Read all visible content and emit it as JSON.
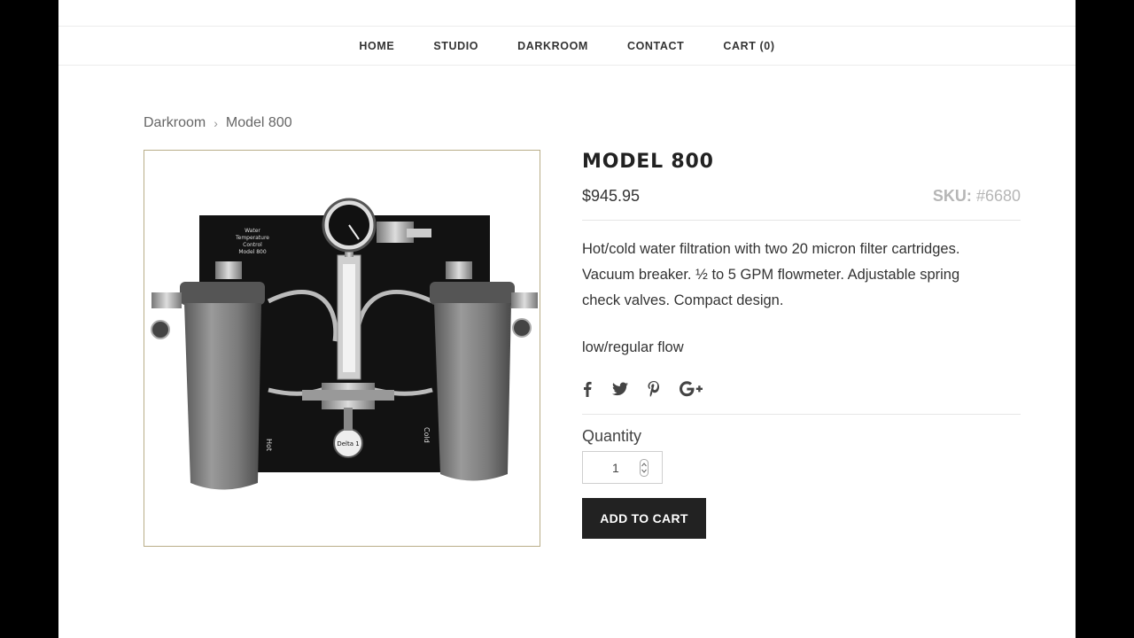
{
  "nav": {
    "items": [
      {
        "label": "HOME"
      },
      {
        "label": "STUDIO"
      },
      {
        "label": "DARKROOM"
      },
      {
        "label": "CONTACT"
      },
      {
        "label": "CART (0)"
      }
    ]
  },
  "breadcrumb": {
    "parent": "Darkroom",
    "separator": "›",
    "current": "Model 800"
  },
  "product": {
    "title": "MODEL 800",
    "price": "$945.95",
    "sku_label": "SKU:",
    "sku_value": "#6680",
    "description": "Hot/cold water filtration with two 20 micron filter cartridges. Vacuum breaker. ½ to 5 GPM flowmeter. Adjustable spring check valves. Compact design.",
    "variant": "low/regular flow",
    "image_labels": {
      "panel_text": [
        "Water",
        "Temperature",
        "Control",
        "Model 800"
      ],
      "hot": "Hot",
      "cold": "Cold",
      "gauge": "Delta 1"
    }
  },
  "social": {
    "icons": [
      "facebook-icon",
      "twitter-icon",
      "pinterest-icon",
      "google-plus-icon"
    ]
  },
  "quantity": {
    "label": "Quantity",
    "value": "1"
  },
  "cart_button": {
    "label": "ADD TO CART"
  },
  "colors": {
    "accent_dark": "#222222",
    "photo_border": "#b9ad88",
    "sku": "#b6b6b6"
  }
}
